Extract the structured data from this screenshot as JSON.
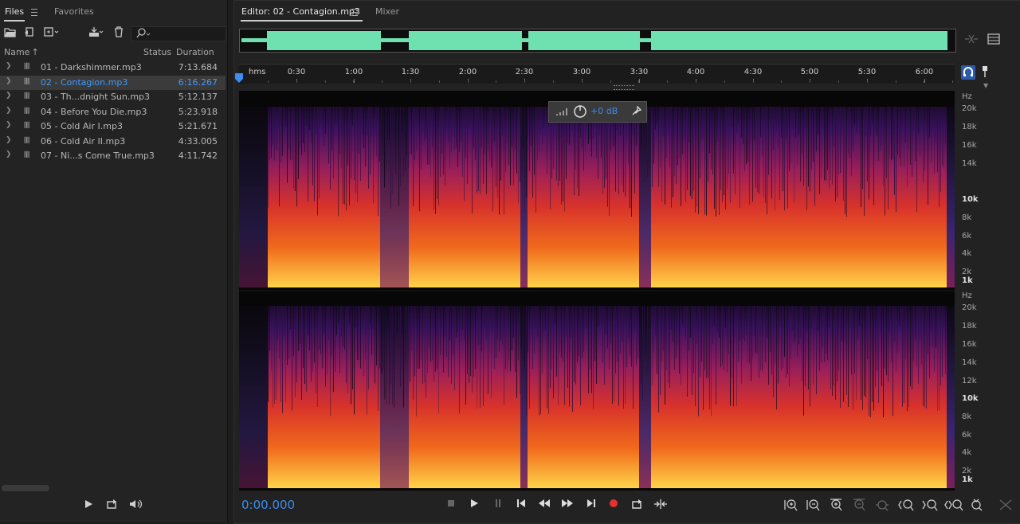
{
  "files_panel": {
    "tab_files": "Files",
    "tab_favorites": "Favorites",
    "col_name": "Name",
    "col_sort": "↑",
    "col_status": "Status",
    "col_duration": "Duration",
    "files": [
      {
        "name": "01 - Darkshimmer.mp3",
        "duration": "7:13.684",
        "selected": false
      },
      {
        "name": "02 - Contagion.mp3",
        "duration": "6:16.267",
        "selected": true
      },
      {
        "name": "03 - Th...dnight Sun.mp3",
        "duration": "5:12.137",
        "selected": false
      },
      {
        "name": "04 - Before You Die.mp3",
        "duration": "5:23.918",
        "selected": false
      },
      {
        "name": "05 - Cold Air I.mp3",
        "duration": "5:21.671",
        "selected": false
      },
      {
        "name": "06 - Cold Air II.mp3",
        "duration": "4:33.005",
        "selected": false
      },
      {
        "name": "07 - Ni...s Come True.mp3",
        "duration": "4:11.742",
        "selected": false
      }
    ]
  },
  "editor": {
    "tab_editor": "Editor: 02 - Contagion.mp3",
    "tab_mixer": "Mixer",
    "ruler_unit": "hms",
    "ruler_labels": [
      "0:30",
      "1:00",
      "1:30",
      "2:00",
      "2:30",
      "3:00",
      "3:30",
      "4:00",
      "4:30",
      "5:00",
      "5:30",
      "6:00"
    ],
    "hz_unit": "Hz",
    "hz_labels": [
      {
        "t": "20k",
        "bold": false
      },
      {
        "t": "18k",
        "bold": false
      },
      {
        "t": "16k",
        "bold": false
      },
      {
        "t": "14k",
        "bold": false
      },
      {
        "t": "12k",
        "bold": false
      },
      {
        "t": "10k",
        "bold": true
      },
      {
        "t": "8k",
        "bold": false
      },
      {
        "t": "6k",
        "bold": false
      },
      {
        "t": "4k",
        "bold": false
      },
      {
        "t": "2k",
        "bold": false
      },
      {
        "t": "1k",
        "bold": true
      }
    ],
    "hud_gain": "+0 dB",
    "timecode": "0:00.000"
  },
  "colors": {
    "accent": "#3d8cf0",
    "waveform": "#6fe0b0",
    "record": "#e8312f"
  }
}
